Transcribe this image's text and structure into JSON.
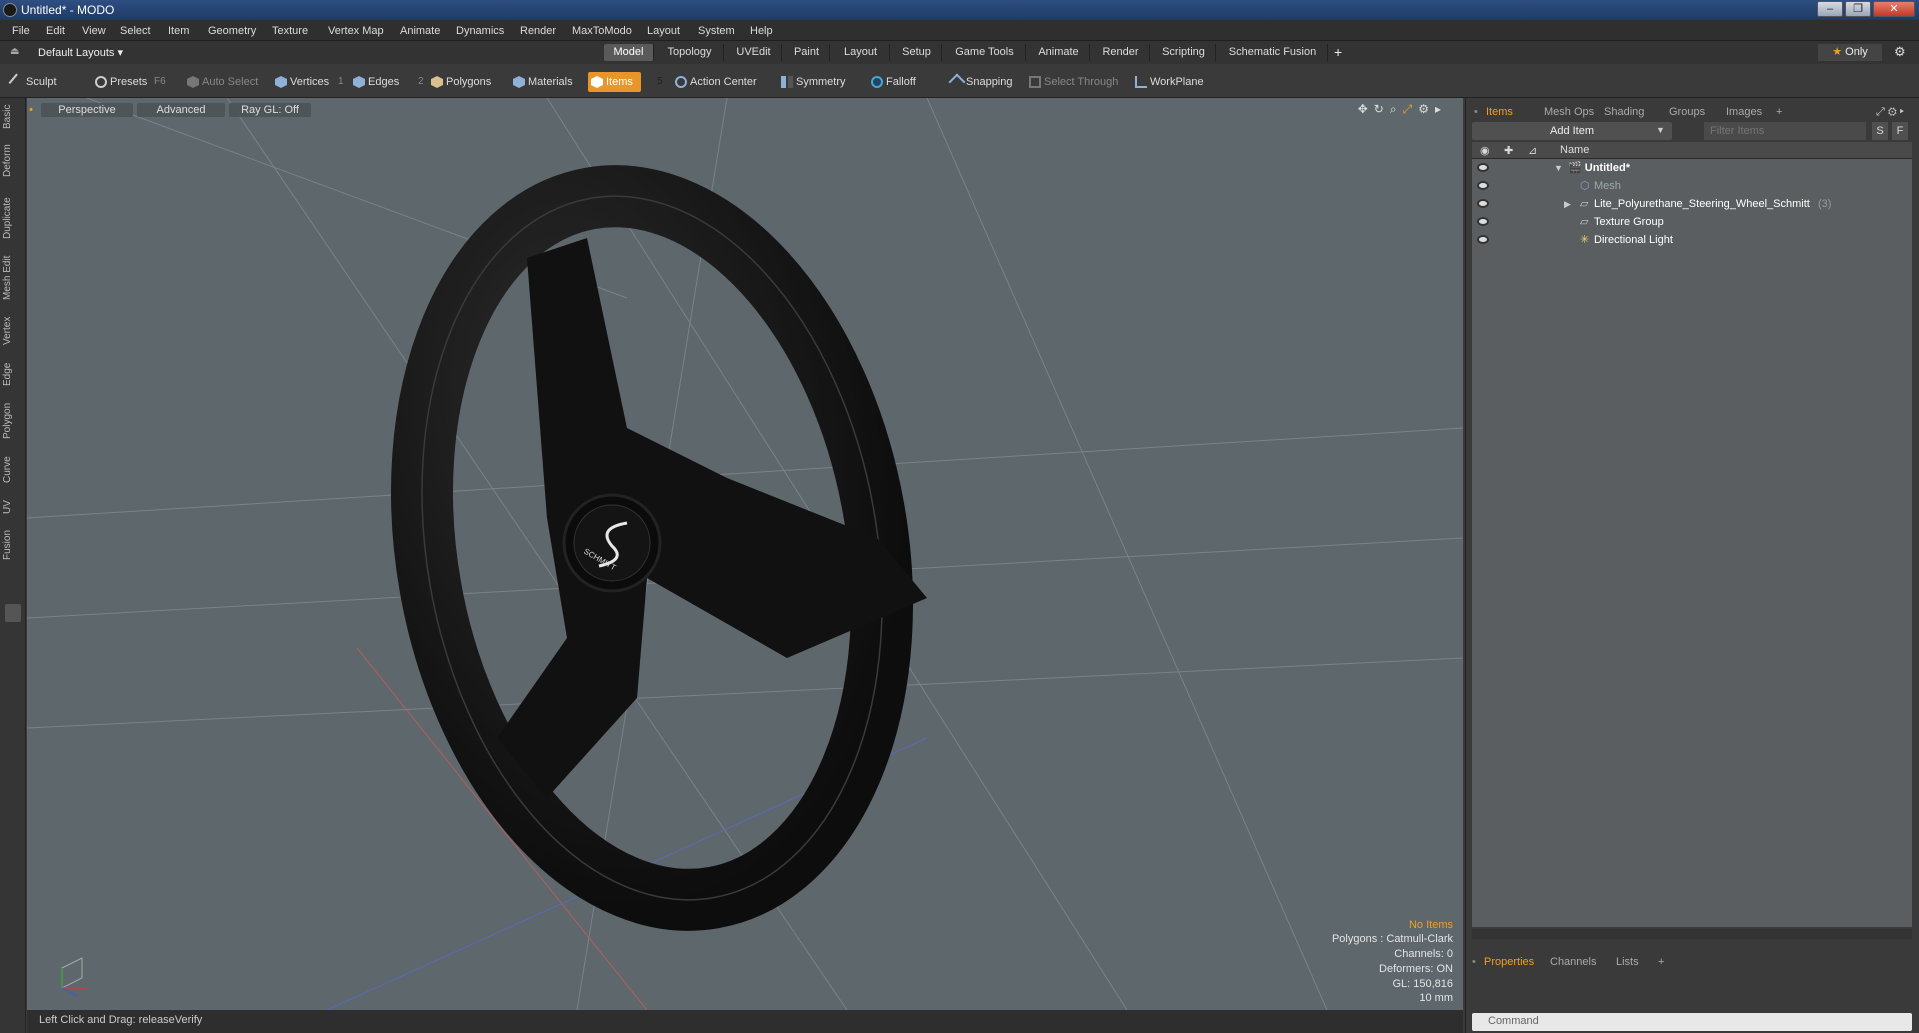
{
  "window": {
    "title": "Untitled* - MODO",
    "min": "–",
    "max": "❐",
    "close": "✕"
  },
  "menu": [
    "File",
    "Edit",
    "View",
    "Select",
    "Item",
    "Geometry",
    "Texture",
    "Vertex Map",
    "Animate",
    "Dynamics",
    "Render",
    "MaxToModo",
    "Layout",
    "System",
    "Help"
  ],
  "layoutbar": {
    "layout_label": "Default Layouts",
    "tabs": [
      "Model",
      "Topology",
      "UVEdit",
      "Paint",
      "Layout",
      "Setup",
      "Game Tools",
      "Animate",
      "Render",
      "Scripting",
      "Schematic Fusion"
    ],
    "active_tab": "Model",
    "plus": "+",
    "only": "Only"
  },
  "toolbar": {
    "sculpt": "Sculpt",
    "presets": "Presets",
    "presets_key": "F6",
    "auto_select": "Auto Select",
    "vertices": "Vertices",
    "vertices_key": "1",
    "edges": "Edges",
    "edges_key": "2",
    "polygons": "Polygons",
    "materials": "Materials",
    "items": "Items",
    "items_key": "5",
    "action_center": "Action Center",
    "symmetry": "Symmetry",
    "falloff": "Falloff",
    "snapping": "Snapping",
    "select_through": "Select Through",
    "workplane": "WorkPlane"
  },
  "left_tabs": [
    "Basic",
    "Deform",
    "Duplicate",
    "Mesh Edit",
    "Vertex",
    "Edge",
    "Polygon",
    "Curve",
    "UV",
    "Fusion"
  ],
  "viewport": {
    "perspective": "Perspective",
    "advanced": "Advanced",
    "raygl": "Ray GL: Off",
    "logo": "SCHMITT",
    "info": {
      "no_items": "No Items",
      "polygons": "Polygons : Catmull-Clark",
      "channels": "Channels: 0",
      "deformers": "Deformers: ON",
      "gl": "GL: 150,816",
      "scale": "10 mm"
    }
  },
  "status": {
    "text": "Left Click and Drag:  releaseVerify"
  },
  "right_panel": {
    "tabs": [
      "Items",
      "Mesh Ops",
      "Shading",
      "Groups",
      "Images"
    ],
    "plus": "+",
    "add_item": "Add Item",
    "filter_placeholder": "Filter Items",
    "s_btn": "S",
    "f_btn": "F",
    "name_header": "Name",
    "tree": [
      {
        "label": "Untitled*",
        "count": ""
      },
      {
        "label": "Mesh",
        "count": ""
      },
      {
        "label": "Lite_Polyurethane_Steering_Wheel_Schmitt",
        "count": "(3)"
      },
      {
        "label": "Texture Group",
        "count": ""
      },
      {
        "label": "Directional Light",
        "count": ""
      }
    ],
    "bottom_tabs": [
      "Properties",
      "Channels",
      "Lists"
    ],
    "command_placeholder": "Command"
  },
  "colors": {
    "accent": "#f0a020",
    "viewport_bg": "#5e676c",
    "titlebar": "#2e4f82"
  }
}
